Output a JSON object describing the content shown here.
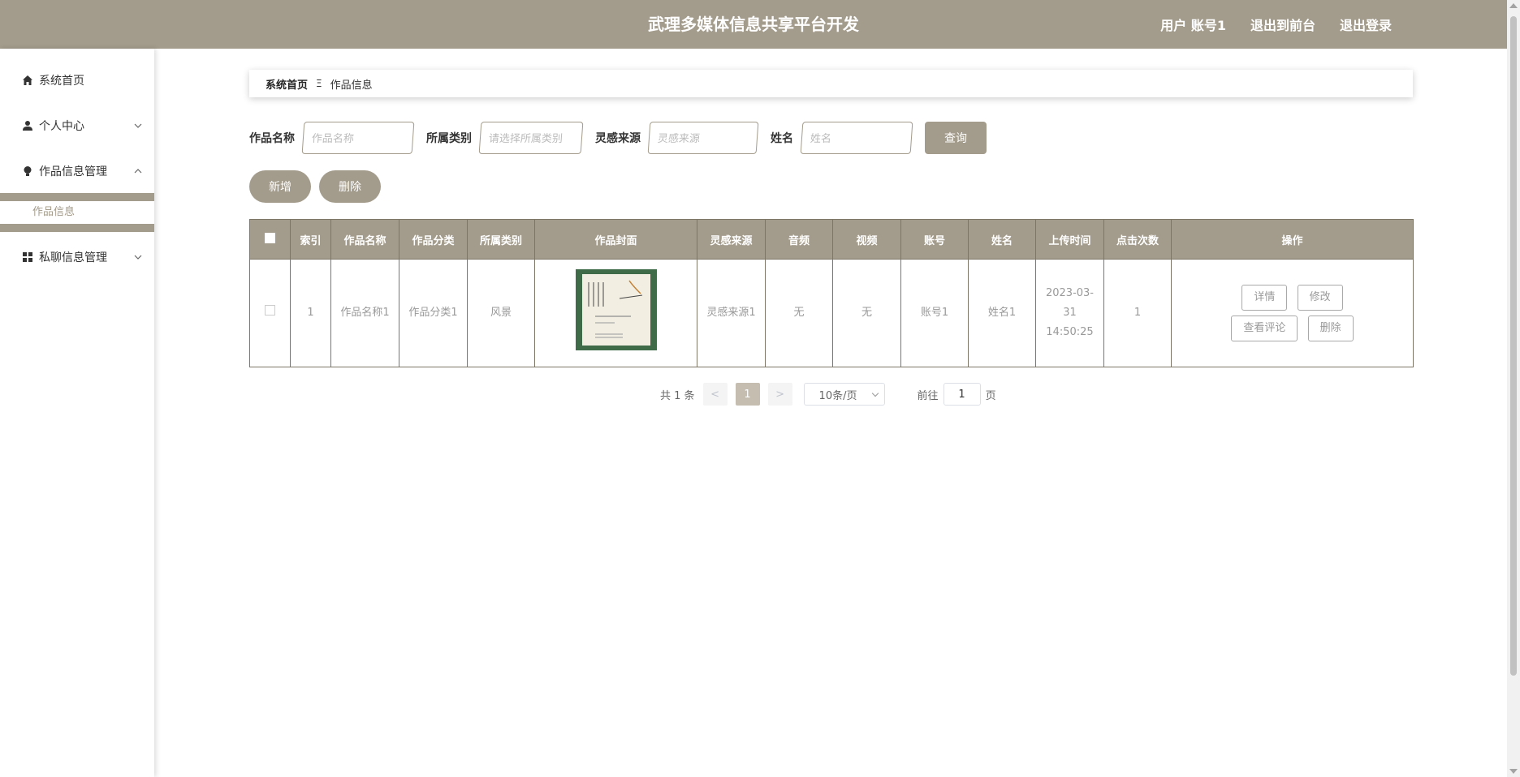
{
  "header": {
    "title": "武理多媒体信息共享平台开发",
    "user_label": "用户 账号1",
    "front_label": "退出到前台",
    "logout_label": "退出登录"
  },
  "sidebar": {
    "items": [
      {
        "label": "系统首页",
        "icon": "home-icon"
      },
      {
        "label": "个人中心",
        "icon": "user-icon"
      },
      {
        "label": "作品信息管理",
        "icon": "bulb-icon"
      },
      {
        "label": "私聊信息管理",
        "icon": "grid-icon"
      }
    ],
    "submenu": {
      "label": "作品信息"
    }
  },
  "breadcrumb": {
    "home": "系统首页",
    "separator": "Ξ",
    "current": "作品信息"
  },
  "search": {
    "fields": [
      {
        "label": "作品名称",
        "placeholder": "作品名称"
      },
      {
        "label": "所属类别",
        "placeholder": "请选择所属类别"
      },
      {
        "label": "灵感来源",
        "placeholder": "灵感来源"
      },
      {
        "label": "姓名",
        "placeholder": "姓名"
      }
    ],
    "query_label": "查询"
  },
  "actions": {
    "add_label": "新增",
    "delete_label": "删除"
  },
  "table": {
    "headers": [
      "索引",
      "作品名称",
      "作品分类",
      "所属类别",
      "作品封面",
      "灵感来源",
      "音频",
      "视频",
      "账号",
      "姓名",
      "上传时间",
      "点击次数",
      "操作"
    ],
    "rows": [
      {
        "index": "1",
        "name": "作品名称1",
        "category": "作品分类1",
        "type": "风景",
        "inspiration": "灵感来源1",
        "audio": "无",
        "video": "无",
        "account": "账号1",
        "username": "姓名1",
        "upload_time": "2023-03-31 14:50:25",
        "clicks": "1",
        "ops": {
          "detail": "详情",
          "edit": "修改",
          "comments": "查看评论",
          "delete": "删除"
        }
      }
    ]
  },
  "pagination": {
    "total": "共 1 条",
    "prev": "<",
    "current_page": "1",
    "next": ">",
    "page_size": "10条/页",
    "goto_prefix": "前往",
    "goto_value": "1",
    "goto_suffix": "页"
  },
  "colors": {
    "accent": "#a39b8b"
  }
}
